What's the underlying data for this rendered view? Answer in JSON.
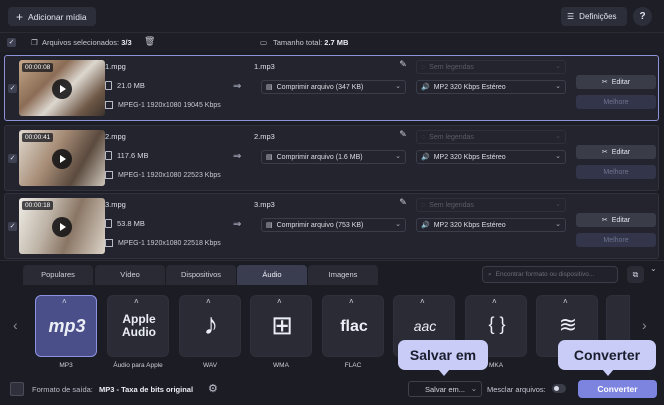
{
  "toolbar": {
    "add_media_label": "Adicionar mídia",
    "settings_label": "Definições",
    "help_label": "?"
  },
  "selection": {
    "selected_label": "Arquivos selecionados:",
    "selected_count": "3/3",
    "total_size_label": "Tamanho total:",
    "total_size_value": "2.7 MB"
  },
  "files": [
    {
      "duration": "00:00:08",
      "name": "1.mpg",
      "size": "21.0 MB",
      "meta": "MPEG-1 1920x1080 19045 Kbps",
      "output_name": "1.mp3",
      "subtitles": "Sem legendas",
      "compress": "Comprimir arquivo (347 KB)",
      "audio": "MP2 320 Kbps Estéreo",
      "edit_label": "Editar",
      "better_label": "Melhore"
    },
    {
      "duration": "00:00:41",
      "name": "2.mpg",
      "size": "117.6 MB",
      "meta": "MPEG-1 1920x1080 22523 Kbps",
      "output_name": "2.mp3",
      "subtitles": "Sem legendas",
      "compress": "Comprimir arquivo (1.6 MB)",
      "audio": "MP2 320 Kbps Estéreo",
      "edit_label": "Editar",
      "better_label": "Melhore"
    },
    {
      "duration": "00:00:18",
      "name": "3.mpg",
      "size": "53.8 MB",
      "meta": "MPEG-1 1920x1080 22518 Kbps",
      "output_name": "3.mp3",
      "subtitles": "Sem legendas",
      "compress": "Comprimir arquivo (753 KB)",
      "audio": "MP2 320 Kbps Estéreo",
      "edit_label": "Editar",
      "better_label": "Melhore"
    }
  ],
  "tabs": [
    "Populares",
    "Vídeo",
    "Dispositivos",
    "Áudio",
    "Imagens"
  ],
  "active_tab": "Áudio",
  "format_search_placeholder": "Encontrar formato ou dispositivo...",
  "formats": [
    {
      "logo": "mp3",
      "label": "MP3",
      "icon": "mp3-icon"
    },
    {
      "logo": "Apple Audio",
      "label": "Áudio para Apple",
      "icon": "apple-audio-icon"
    },
    {
      "logo": "♪",
      "label": "WAV",
      "icon": "wav-note-icon"
    },
    {
      "logo": "⊞",
      "label": "WMA",
      "icon": "windows-icon"
    },
    {
      "logo": "flac",
      "label": "FLAC",
      "icon": "flac-icon"
    },
    {
      "logo": "aac",
      "label": "",
      "icon": "aac-icon"
    },
    {
      "logo": "{ }",
      "label": "MKA",
      "icon": "mka-icon"
    },
    {
      "logo": "≋",
      "label": "",
      "icon": "ogg-icon"
    }
  ],
  "output": {
    "format_label": "Formato de saída:",
    "format_value": "MP3 - Taxa de bits original",
    "save_label": "Salvar em...",
    "merge_label": "Mesclar arquivos:",
    "convert_label": "Converter"
  },
  "callouts": {
    "save": "Salvar em",
    "convert": "Converter"
  }
}
